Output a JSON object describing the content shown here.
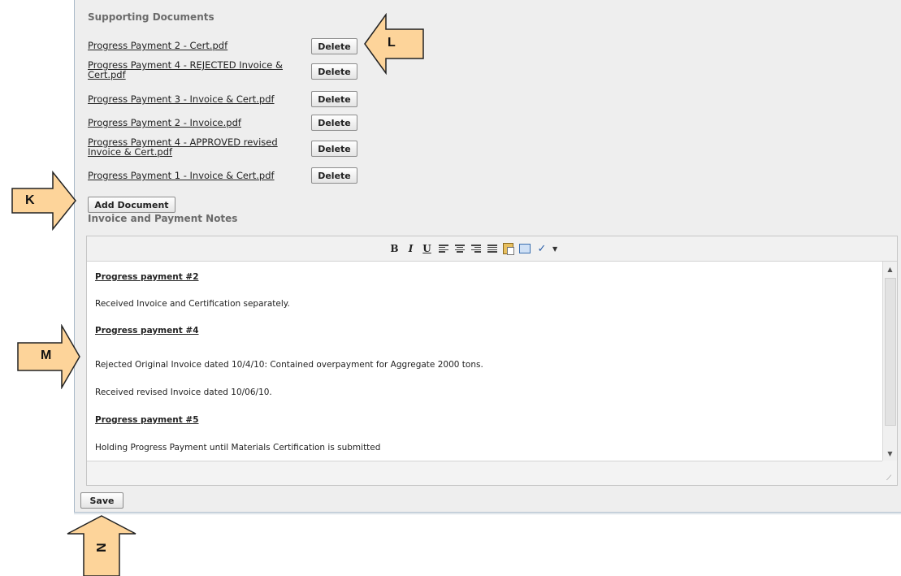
{
  "supporting_documents": {
    "heading": "Supporting Documents",
    "delete_label": "Delete",
    "add_label": "Add Document",
    "documents": [
      "Progress Payment 2 - Cert.pdf",
      "Progress Payment 4 - REJECTED Invoice & Cert.pdf",
      "Progress Payment 3 - Invoice & Cert.pdf",
      "Progress Payment 2 - Invoice.pdf",
      "Progress Payment 4 - APPROVED revised Invoice & Cert.pdf",
      "Progress Payment 1 - Invoice & Cert.pdf"
    ]
  },
  "notes": {
    "heading": "Invoice and Payment Notes",
    "toolbar_icons": [
      "bold-icon",
      "italic-icon",
      "underline-icon",
      "align-left-icon",
      "align-center-icon",
      "align-right-icon",
      "justify-icon",
      "paste-icon",
      "fullscreen-icon",
      "spellcheck-icon"
    ],
    "toolbar_glyphs": {
      "bold": "B",
      "italic": "I",
      "underline": "U"
    },
    "paragraphs": [
      {
        "text": "Progress payment #2",
        "style": "sub"
      },
      {
        "text": "Received Invoice and Certification separately.",
        "style": "body"
      },
      {
        "text": "Progress payment #4",
        "style": "sub"
      },
      {
        "text": "Rejected Original Invoice dated 10/4/10: Contained overpayment for Aggregate 2000 tons.",
        "style": "body"
      },
      {
        "text": "Received revised Invoice dated 10/06/10.",
        "style": "body"
      },
      {
        "text": "Progress payment #5",
        "style": "sub"
      },
      {
        "text": "Holding Progress Payment until Materials Certification is submitted",
        "style": "body"
      }
    ]
  },
  "save_label": "Save",
  "callouts": {
    "k": "K",
    "l": "L",
    "m": "M",
    "n": "N"
  },
  "colors": {
    "callout_fill": "#fdd49a",
    "callout_stroke": "#222222",
    "panel_bg": "#eeeeee"
  }
}
